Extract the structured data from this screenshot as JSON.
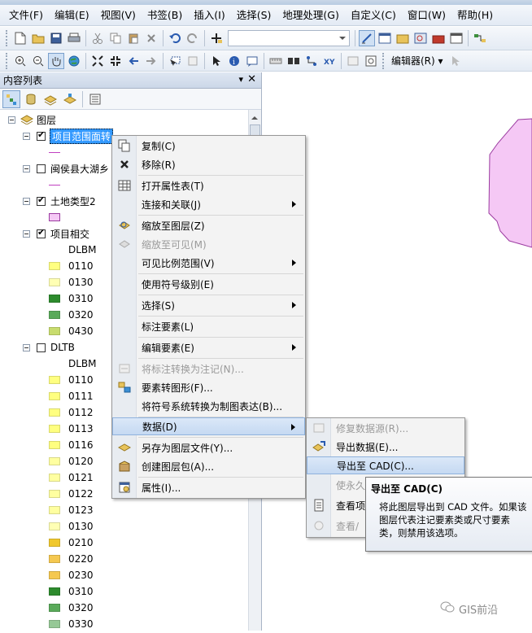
{
  "menubar": {
    "items": [
      "文件(F)",
      "编辑(E)",
      "视图(V)",
      "书签(B)",
      "插入(I)",
      "选择(S)",
      "地理处理(G)",
      "自定义(C)",
      "窗口(W)",
      "帮助(H)"
    ]
  },
  "toolbar2": {
    "editor_label": "编辑器(R) ▾"
  },
  "toc": {
    "title": "内容列表",
    "pin": "▾",
    "close": "✕",
    "root": "图层",
    "layers": [
      {
        "name": "项目范围面转",
        "checked": true
      },
      {
        "name": "闽侯县大湖乡",
        "checked": false
      },
      {
        "name": "土地类型2",
        "checked": true
      },
      {
        "name": "项目相交",
        "checked": true,
        "field": "DLBM",
        "classes": [
          {
            "code": "0110",
            "color": "#ffff80"
          },
          {
            "code": "0130",
            "color": "#ffffb4"
          },
          {
            "code": "0310",
            "color": "#2d8b2d"
          },
          {
            "code": "0320",
            "color": "#5aaa5a"
          },
          {
            "code": "0430",
            "color": "#c8dc6e"
          }
        ]
      },
      {
        "name": "DLTB",
        "checked": false,
        "field": "DLBM",
        "classes": [
          {
            "code": "0110",
            "color": "#ffff80"
          },
          {
            "code": "0111",
            "color": "#ffff80"
          },
          {
            "code": "0112",
            "color": "#ffff80"
          },
          {
            "code": "0113",
            "color": "#ffff80"
          },
          {
            "code": "0116",
            "color": "#ffff80"
          },
          {
            "code": "0120",
            "color": "#ffffa0"
          },
          {
            "code": "0121",
            "color": "#ffffa0"
          },
          {
            "code": "0122",
            "color": "#ffffa0"
          },
          {
            "code": "0123",
            "color": "#ffffa0"
          },
          {
            "code": "0130",
            "color": "#ffffb4"
          },
          {
            "code": "0210",
            "color": "#f0c82d"
          },
          {
            "code": "0220",
            "color": "#f5c850"
          },
          {
            "code": "0230",
            "color": "#f5c850"
          },
          {
            "code": "0310",
            "color": "#2d8b2d"
          },
          {
            "code": "0320",
            "color": "#5aaa5a"
          },
          {
            "code": "0330",
            "color": "#96c896"
          }
        ]
      }
    ]
  },
  "context_menu": {
    "items": [
      {
        "label": "复制(C)",
        "icon": "copy-icon",
        "enabled": true,
        "submenu": false
      },
      {
        "label": "移除(R)",
        "icon": "remove-icon",
        "enabled": true,
        "submenu": false
      },
      {
        "label": "打开属性表(T)",
        "icon": "table-icon",
        "enabled": true,
        "submenu": false
      },
      {
        "label": "连接和关联(J)",
        "icon": "",
        "enabled": true,
        "submenu": true
      },
      {
        "label": "缩放至图层(Z)",
        "icon": "zoom-layer-icon",
        "enabled": true,
        "submenu": false
      },
      {
        "label": "缩放至可见(M)",
        "icon": "zoom-visible-icon",
        "enabled": false,
        "submenu": false
      },
      {
        "label": "可见比例范围(V)",
        "icon": "",
        "enabled": true,
        "submenu": true
      },
      {
        "label": "使用符号级别(E)",
        "icon": "",
        "enabled": true,
        "submenu": false
      },
      {
        "label": "选择(S)",
        "icon": "",
        "enabled": true,
        "submenu": true
      },
      {
        "label": "标注要素(L)",
        "icon": "",
        "enabled": true,
        "submenu": false
      },
      {
        "label": "编辑要素(E)",
        "icon": "",
        "enabled": true,
        "submenu": true
      },
      {
        "label": "将标注转换为注记(N)...",
        "icon": "convert-labels-icon",
        "enabled": false,
        "submenu": false
      },
      {
        "label": "要素转图形(F)...",
        "icon": "features-to-graphics-icon",
        "enabled": true,
        "submenu": false
      },
      {
        "label": "将符号系统转换为制图表达(B)...",
        "icon": "",
        "enabled": true,
        "submenu": false
      },
      {
        "label": "数据(D)",
        "icon": "",
        "enabled": true,
        "submenu": true
      },
      {
        "label": "另存为图层文件(Y)...",
        "icon": "layer-file-icon",
        "enabled": true,
        "submenu": false
      },
      {
        "label": "创建图层包(A)...",
        "icon": "layer-package-icon",
        "enabled": true,
        "submenu": false
      },
      {
        "label": "属性(I)...",
        "icon": "properties-icon",
        "enabled": true,
        "submenu": false
      }
    ]
  },
  "data_submenu": {
    "items": [
      {
        "label": "修复数据源(R)...",
        "enabled": false
      },
      {
        "label": "导出数据(E)...",
        "enabled": true
      },
      {
        "label": "导出至 CAD(C)...",
        "enabled": true
      },
      {
        "label": "使永久",
        "enabled": false
      },
      {
        "label": "查看项",
        "enabled": true
      },
      {
        "label": "查看/",
        "enabled": false
      }
    ]
  },
  "tooltip": {
    "title": "导出至 CAD(C)",
    "body": "将此图层导出到 CAD 文件。如果该图层代表注记要素类或尺寸要素类，则禁用该选项。"
  },
  "map": {
    "polygon_fill": "#f5c8f5",
    "polygon_stroke": "#9b3ba0"
  },
  "watermark": "GIS前沿"
}
